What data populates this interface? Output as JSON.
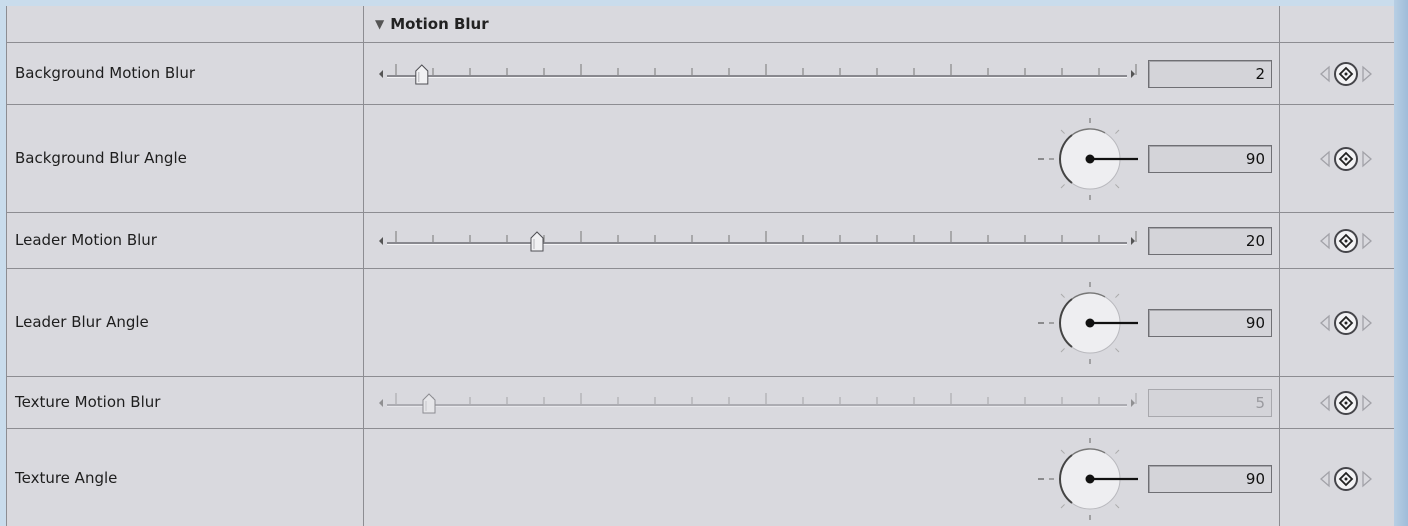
{
  "header": {
    "title": "Motion Blur"
  },
  "rows": [
    {
      "label": "Background Motion Blur",
      "control": "slider",
      "value": "2",
      "slider_fraction": 0.04,
      "disabled": false
    },
    {
      "label": "Background Blur Angle",
      "control": "dial",
      "value": "90"
    },
    {
      "label": "Leader Motion Blur",
      "control": "slider",
      "value": "20",
      "slider_fraction": 0.2,
      "disabled": false
    },
    {
      "label": "Leader Blur Angle",
      "control": "dial",
      "value": "90"
    },
    {
      "label": "Texture Motion Blur",
      "control": "slider",
      "value": "5",
      "slider_fraction": 0.05,
      "disabled": true
    },
    {
      "label": "Texture Angle",
      "control": "dial",
      "value": "90"
    }
  ],
  "icons": {
    "disclosure": "disclosure-triangle-icon",
    "slider_left": "arrow-left-icon",
    "slider_right": "arrow-right-icon",
    "keyframe_prev": "keyframe-prev-icon",
    "keyframe_add": "keyframe-add-icon",
    "keyframe_next": "keyframe-next-icon"
  },
  "colors": {
    "panel": "#d9d9de",
    "border": "#8d8d92",
    "backdrop": "#c9dcec"
  }
}
